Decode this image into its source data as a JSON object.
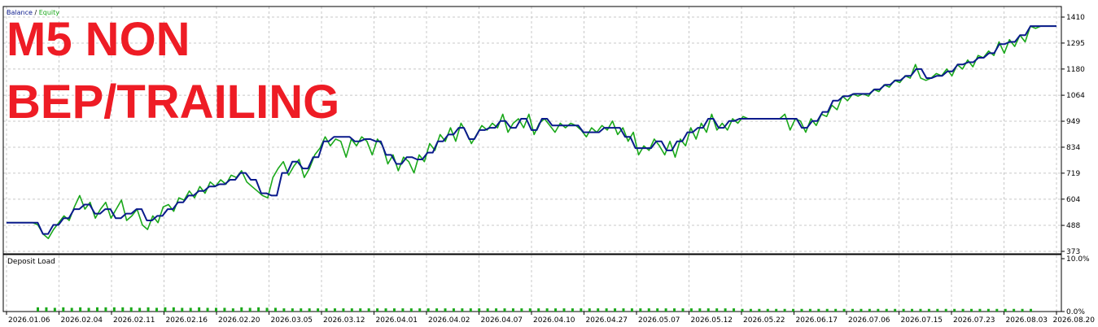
{
  "overlay": {
    "line1": "M5 NON",
    "line2": "BEP/TRAILING"
  },
  "legend": {
    "balance": "Balance",
    "separator": " / ",
    "equity": "Equity"
  },
  "colors": {
    "balance": "#0a1a8c",
    "equity": "#1aa81a",
    "overlay": "#ee1c25",
    "grid": "#c8c8c8",
    "deposit": "#1aa81a"
  },
  "chart_data": [
    {
      "type": "line",
      "ylim": [
        373,
        1450
      ],
      "yticks": [
        "1410",
        "1295",
        "1180",
        "1064",
        "949",
        "834",
        "719",
        "604",
        "488",
        "373"
      ],
      "ytick_values": [
        1410,
        1295,
        1180,
        1064,
        949,
        834,
        719,
        604,
        488,
        373
      ],
      "xticks": [
        "2026.01.06",
        "2026.02.04",
        "2026.02.11",
        "2026.02.16",
        "2026.02.20",
        "2026.03.05",
        "2026.03.12",
        "2026.04.01",
        "2026.04.02",
        "2026.04.07",
        "2026.04.10",
        "2026.04.27",
        "2026.05.07",
        "2026.05.12",
        "2026.05.22",
        "2026.06.17",
        "2026.07.06",
        "2026.07.15",
        "2026.07.23",
        "2026.08.03",
        "2026.08.20"
      ],
      "series": [
        {
          "name": "Balance",
          "y": [
            500,
            500,
            500,
            500,
            500,
            500,
            500,
            450,
            450,
            490,
            490,
            520,
            520,
            560,
            560,
            580,
            580,
            540,
            540,
            560,
            560,
            520,
            520,
            540,
            540,
            560,
            560,
            510,
            510,
            530,
            530,
            560,
            560,
            590,
            590,
            620,
            620,
            640,
            640,
            660,
            660,
            670,
            670,
            690,
            690,
            720,
            720,
            690,
            690,
            630,
            630,
            620,
            620,
            720,
            720,
            770,
            770,
            740,
            740,
            790,
            790,
            860,
            860,
            880,
            880,
            880,
            880,
            860,
            860,
            870,
            870,
            860,
            860,
            800,
            800,
            760,
            760,
            790,
            790,
            780,
            780,
            810,
            810,
            860,
            860,
            890,
            890,
            920,
            920,
            870,
            870,
            910,
            910,
            920,
            920,
            950,
            950,
            920,
            920,
            960,
            960,
            910,
            910,
            960,
            960,
            930,
            930,
            930,
            930,
            930,
            930,
            900,
            900,
            900,
            900,
            920,
            920,
            920,
            920,
            880,
            880,
            830,
            830,
            830,
            830,
            860,
            860,
            820,
            820,
            860,
            860,
            900,
            900,
            920,
            920,
            960,
            960,
            920,
            920,
            950,
            950,
            960,
            960,
            960,
            960,
            960,
            960,
            960,
            960,
            960,
            960,
            960,
            960,
            920,
            920,
            950,
            950,
            990,
            990,
            1040,
            1040,
            1060,
            1060,
            1070,
            1070,
            1070,
            1070,
            1090,
            1090,
            1110,
            1110,
            1130,
            1130,
            1150,
            1150,
            1180,
            1180,
            1140,
            1140,
            1150,
            1150,
            1170,
            1170,
            1200,
            1200,
            1210,
            1210,
            1230,
            1230,
            1250,
            1250,
            1290,
            1290,
            1300,
            1300,
            1330,
            1330,
            1370,
            1370,
            1370,
            1370,
            1370,
            1370
          ]
        },
        {
          "name": "Equity",
          "y": [
            500,
            500,
            500,
            500,
            500,
            500,
            490,
            450,
            430,
            470,
            500,
            530,
            510,
            570,
            620,
            560,
            590,
            520,
            560,
            590,
            520,
            560,
            600,
            510,
            530,
            560,
            490,
            470,
            530,
            500,
            570,
            580,
            550,
            610,
            600,
            640,
            610,
            660,
            630,
            680,
            660,
            690,
            670,
            710,
            700,
            730,
            680,
            660,
            640,
            620,
            610,
            700,
            740,
            770,
            710,
            750,
            780,
            700,
            740,
            800,
            830,
            880,
            840,
            870,
            860,
            790,
            870,
            840,
            880,
            860,
            800,
            870,
            840,
            760,
            800,
            730,
            790,
            770,
            720,
            800,
            770,
            850,
            820,
            890,
            860,
            920,
            860,
            940,
            900,
            850,
            890,
            930,
            910,
            940,
            920,
            980,
            900,
            940,
            960,
            920,
            980,
            890,
            940,
            960,
            930,
            900,
            940,
            920,
            940,
            930,
            910,
            880,
            920,
            900,
            930,
            910,
            950,
            890,
            920,
            860,
            900,
            800,
            840,
            820,
            870,
            840,
            800,
            860,
            790,
            870,
            840,
            920,
            870,
            940,
            900,
            980,
            910,
            940,
            910,
            960,
            940,
            970,
            960,
            960,
            960,
            960,
            960,
            960,
            960,
            980,
            910,
            960,
            950,
            900,
            960,
            930,
            980,
            970,
            1020,
            1000,
            1060,
            1040,
            1070,
            1060,
            1070,
            1060,
            1090,
            1080,
            1110,
            1100,
            1130,
            1120,
            1150,
            1140,
            1200,
            1140,
            1130,
            1140,
            1160,
            1150,
            1180,
            1150,
            1200,
            1180,
            1220,
            1190,
            1240,
            1230,
            1260,
            1240,
            1300,
            1250,
            1310,
            1280,
            1330,
            1300,
            1370,
            1360,
            1370,
            1370,
            1370,
            1370
          ]
        }
      ]
    },
    {
      "type": "bar",
      "title": "Deposit Load",
      "ylim": [
        0,
        10
      ],
      "yticks": [
        "10.0%",
        "0.0%"
      ],
      "ytick_values": [
        10,
        0
      ],
      "values": [
        0.8,
        0.8,
        0.7,
        0.8,
        0.7,
        0.8,
        0.7,
        0.8,
        0.8,
        0.8,
        0.8,
        0.8,
        0.7,
        0.8,
        0.7,
        0.8,
        0.8,
        0.7,
        0.7,
        0.8,
        0.7,
        0.7,
        0.7,
        0.6,
        0.8,
        0.7,
        0.8,
        0.7,
        0.7,
        0.6,
        0.6,
        0.6,
        0.6,
        0.6,
        0.6,
        0.6,
        0.6,
        0.6,
        0.6,
        0.6,
        0.6,
        0.6,
        0.6,
        0.6,
        0.6,
        0.6,
        0.6,
        0.6,
        0.6,
        0.6,
        0.6,
        0.6,
        0.6,
        0.6,
        0.6,
        0.6,
        0.6,
        0.6,
        0.6,
        0.6,
        0.6,
        0.6,
        0.6,
        0.6,
        0.6,
        0.6,
        0.6,
        0.6,
        0.6,
        0.6,
        0.6,
        0.6,
        0.6,
        0.6,
        0.6,
        0.6,
        0.6,
        0.6,
        0.6,
        0.6,
        0.6,
        0.6,
        0.6,
        0.5,
        0.5,
        0.5,
        0.5,
        0.5,
        0.5,
        0.5,
        0.5,
        0.5,
        0.5,
        0.5,
        0.5,
        0.5,
        0.5,
        0.5,
        0.5,
        0.5,
        0.5,
        0.5,
        0.5,
        0.5,
        0.5,
        0.5,
        0.5,
        0.5,
        0.5,
        0.5,
        0.5,
        0.5,
        0.5,
        0.5,
        0.5,
        0.5,
        0.5,
        0.5
      ]
    }
  ]
}
